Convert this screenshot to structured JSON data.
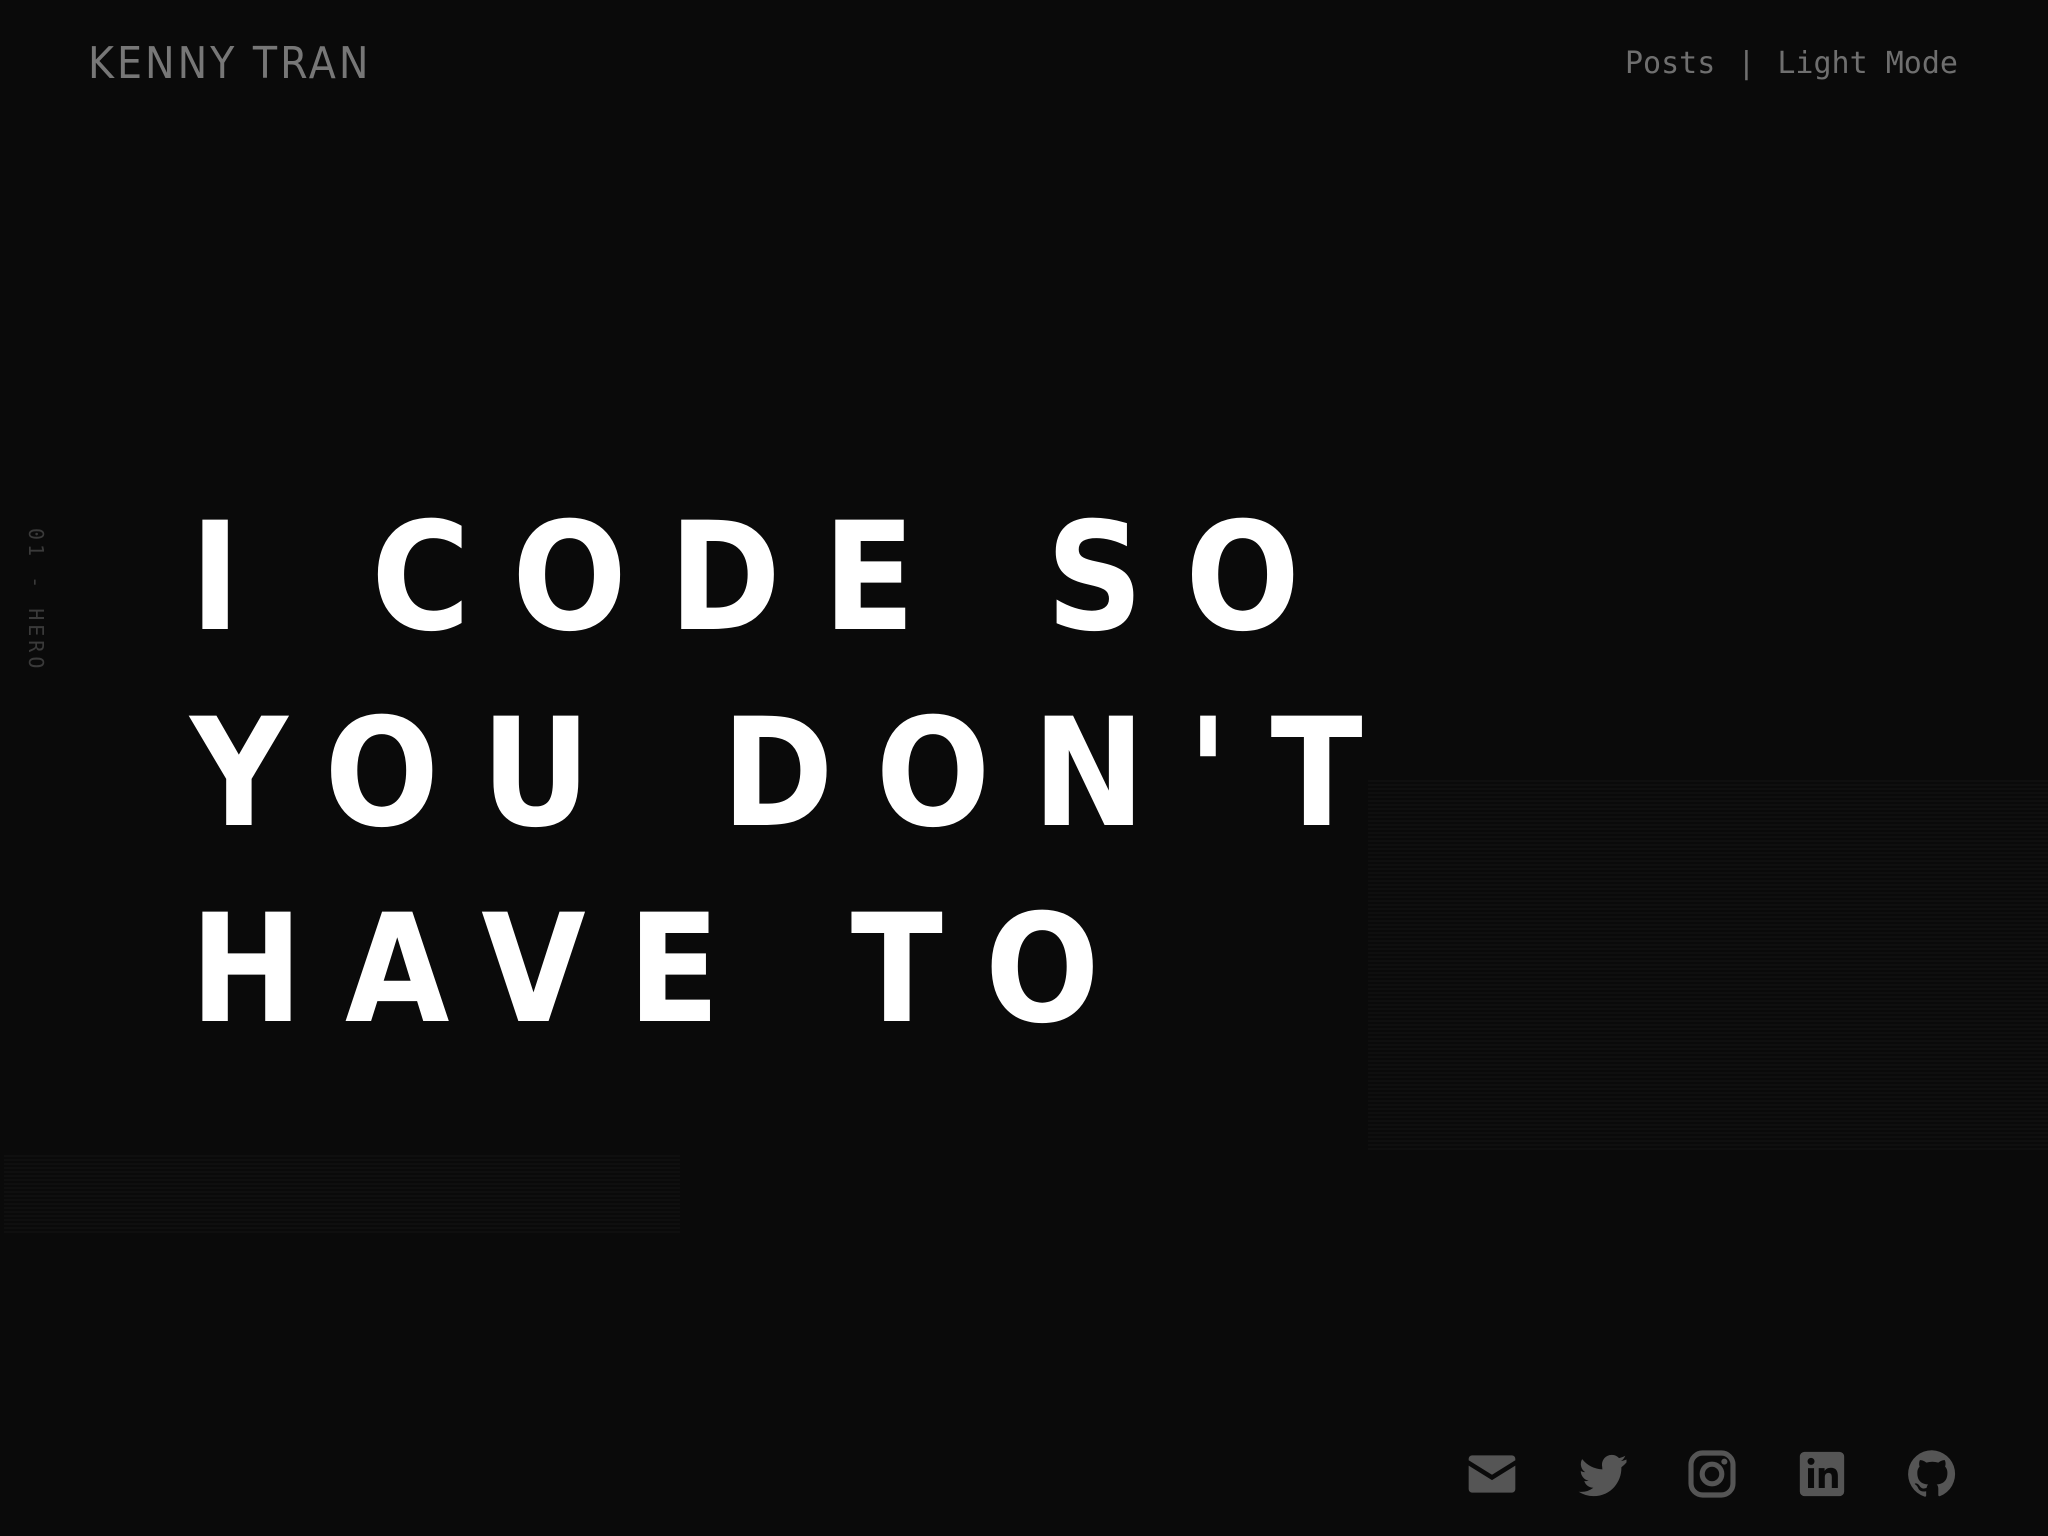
{
  "header": {
    "brand": "KENNY TRAN",
    "nav": {
      "posts": "Posts",
      "separator": "|",
      "light_mode": "Light Mode"
    }
  },
  "section_label": "01 - HERO",
  "hero": {
    "lines": [
      "I CODE SO",
      "YOU DON'T",
      "HAVE TO"
    ]
  },
  "socials": [
    {
      "icon": "mail-icon"
    },
    {
      "icon": "twitter-icon"
    },
    {
      "icon": "instagram-icon"
    },
    {
      "icon": "linkedin-icon"
    },
    {
      "icon": "github-icon"
    }
  ],
  "colors": {
    "background": "#0a0a0a",
    "hero_text": "#ffffff",
    "muted": "#6f6f6f",
    "icon": "#555555"
  }
}
